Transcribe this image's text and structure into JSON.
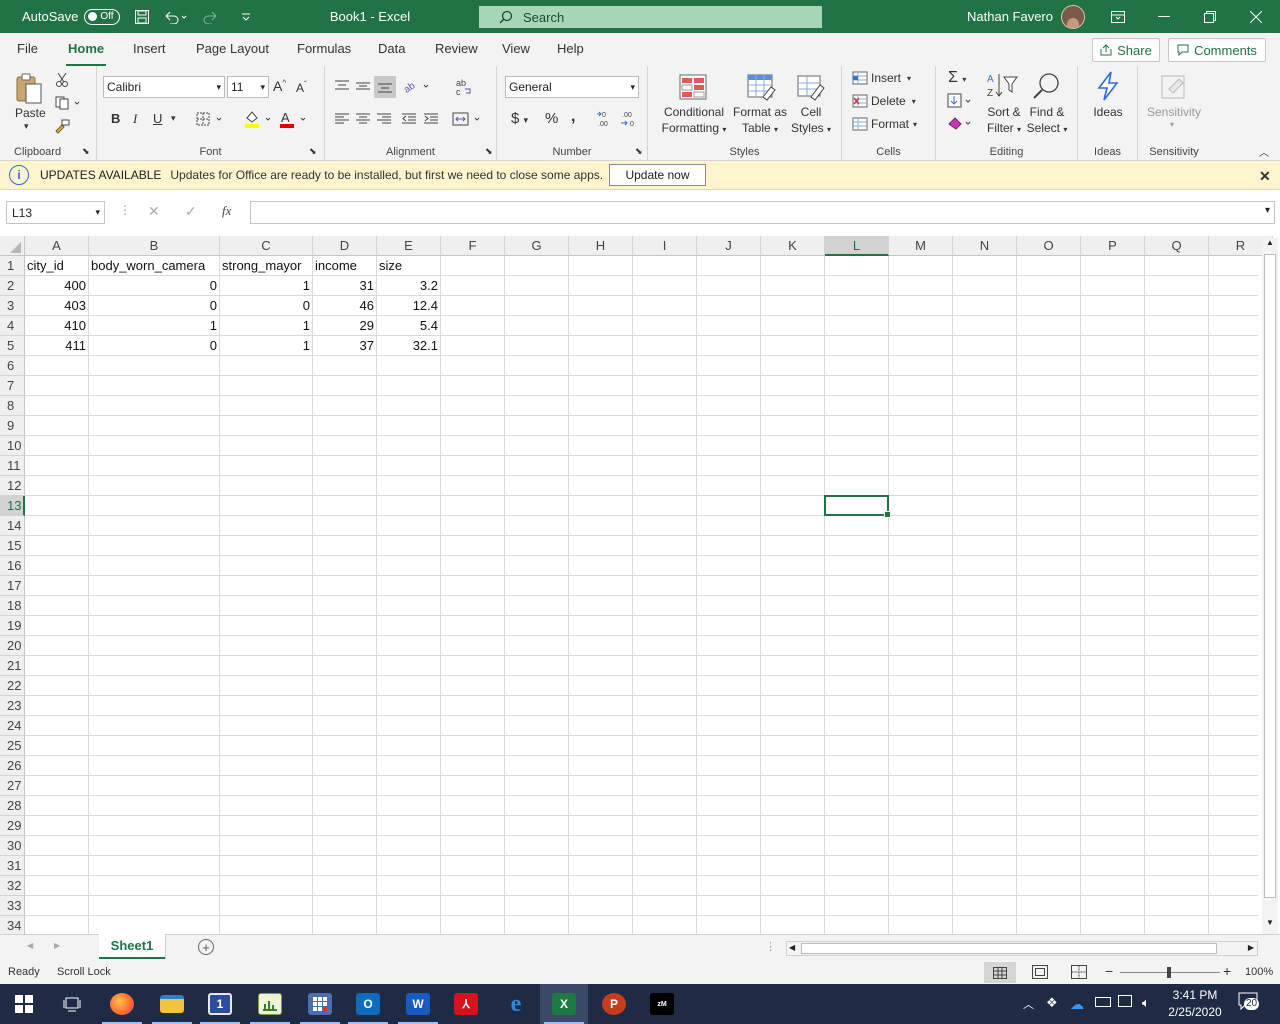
{
  "titlebar": {
    "autosave_label": "AutoSave",
    "autosave_state": "Off",
    "doc_title": "Book1  -  Excel",
    "search_placeholder": "Search",
    "user_name": "Nathan Favero"
  },
  "menu": {
    "tabs": [
      "File",
      "Home",
      "Insert",
      "Page Layout",
      "Formulas",
      "Data",
      "Review",
      "View",
      "Help"
    ],
    "active_tab": "Home",
    "share_label": "Share",
    "comments_label": "Comments"
  },
  "ribbon": {
    "clipboard": {
      "paste": "Paste",
      "label": "Clipboard"
    },
    "font": {
      "name": "Calibri",
      "size": "11",
      "label": "Font",
      "bold": "B",
      "italic": "I",
      "underline": "U"
    },
    "alignment": {
      "label": "Alignment"
    },
    "number": {
      "format": "General",
      "label": "Number"
    },
    "styles": {
      "conditional": "Conditional",
      "conditional2": "Formatting",
      "format_as": "Format as",
      "format_as2": "Table",
      "cell": "Cell",
      "cell2": "Styles",
      "label": "Styles"
    },
    "cells": {
      "insert": "Insert",
      "delete": "Delete",
      "format": "Format",
      "label": "Cells"
    },
    "editing": {
      "sort": "Sort &",
      "sort2": "Filter",
      "find": "Find &",
      "find2": "Select",
      "label": "Editing"
    },
    "ideas": {
      "btn": "Ideas",
      "label": "Ideas"
    },
    "sensitivity": {
      "btn": "Sensitivity",
      "label": "Sensitivity"
    }
  },
  "update_bar": {
    "title": "UPDATES AVAILABLE",
    "message": "Updates for Office are ready to be installed, but first we need to close some apps.",
    "button": "Update now"
  },
  "formula_bar": {
    "name_box": "L13",
    "fx": "fx",
    "formula": ""
  },
  "sheet": {
    "columns": [
      "A",
      "B",
      "C",
      "D",
      "E",
      "F",
      "G",
      "H",
      "I",
      "J",
      "K",
      "L",
      "M",
      "N",
      "O",
      "P",
      "Q",
      "R"
    ],
    "selected_column": "L",
    "selected_row": 13,
    "row_count": 34,
    "headers": [
      "city_id",
      "body_worn_camera",
      "strong_mayor",
      "income",
      "size"
    ],
    "rows": [
      [
        "400",
        "0",
        "1",
        "31",
        "3.2"
      ],
      [
        "403",
        "0",
        "0",
        "46",
        "12.4"
      ],
      [
        "410",
        "1",
        "1",
        "29",
        "5.4"
      ],
      [
        "411",
        "0",
        "1",
        "37",
        "32.1"
      ]
    ]
  },
  "tabs": {
    "sheet1": "Sheet1"
  },
  "status": {
    "ready": "Ready",
    "scroll_lock": "Scroll Lock",
    "zoom": "100%"
  },
  "taskbar": {
    "time": "3:41 PM",
    "date": "2/25/2020",
    "notifications": "20"
  },
  "colors": {
    "excel_green": "#217346",
    "update_bar": "#fff4ce",
    "taskbar": "#1f2a44"
  }
}
